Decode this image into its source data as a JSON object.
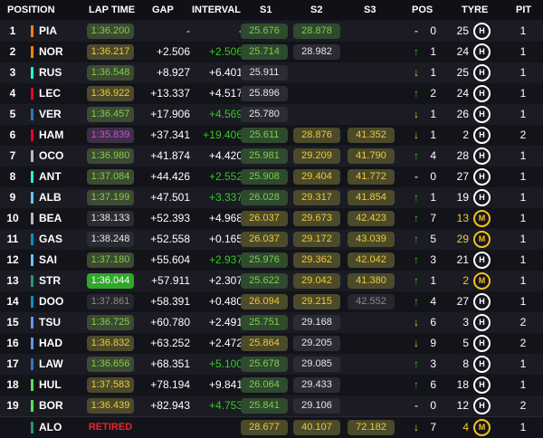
{
  "header": {
    "position": "POSITION",
    "lap_time": "LAP TIME",
    "gap": "GAP",
    "interval": "INTERVAL",
    "s1": "S1",
    "s2": "S2",
    "s3": "S3",
    "pos": "POS",
    "tyre": "TYRE",
    "pit": "PIT"
  },
  "colors": {
    "sector_green": "#7cd14a",
    "sector_yellow": "#efc93a",
    "purple": "#d04ee0",
    "interval_green": "#34c924",
    "retired_red": "#e8262c",
    "medium_tyre": "#f2c318"
  },
  "rows": [
    {
      "pos": "1",
      "driver": "PIA",
      "team_color": "#ff8000",
      "lap": "1:36.200",
      "lap_style": "green",
      "gap": "-",
      "interval": "-",
      "interval_green": false,
      "s1": "25.676",
      "s1_style": "green",
      "s2": "28.878",
      "s2_style": "green",
      "s3": "",
      "s3_style": "",
      "pos_arrow": "-",
      "pos_dir": "same",
      "pos_change": "0",
      "tyre_age": "25",
      "age_style": "",
      "tyre": "H",
      "tyre_type": "hard",
      "pit": "1"
    },
    {
      "pos": "2",
      "driver": "NOR",
      "team_color": "#ff8000",
      "lap": "1:36.217",
      "lap_style": "ylw",
      "gap": "+2.506",
      "interval": "+2.506",
      "interval_green": true,
      "s1": "25.714",
      "s1_style": "green",
      "s2": "28.982",
      "s2_style": "plain",
      "s3": "",
      "s3_style": "",
      "pos_arrow": "↑",
      "pos_dir": "up",
      "pos_change": "1",
      "tyre_age": "24",
      "age_style": "",
      "tyre": "H",
      "tyre_type": "hard",
      "pit": "1"
    },
    {
      "pos": "3",
      "driver": "RUS",
      "team_color": "#27f4d2",
      "lap": "1:36.548",
      "lap_style": "green",
      "gap": "+8.927",
      "interval": "+6.401",
      "interval_green": false,
      "s1": "25.911",
      "s1_style": "plain",
      "s2": "",
      "s2_style": "",
      "s3": "",
      "s3_style": "",
      "pos_arrow": "↓",
      "pos_dir": "down",
      "pos_change": "1",
      "tyre_age": "25",
      "age_style": "",
      "tyre": "H",
      "tyre_type": "hard",
      "pit": "1"
    },
    {
      "pos": "4",
      "driver": "LEC",
      "team_color": "#e8002d",
      "lap": "1:36.922",
      "lap_style": "ylw",
      "gap": "+13.337",
      "interval": "+4.517",
      "interval_green": false,
      "s1": "25.896",
      "s1_style": "plain",
      "s2": "",
      "s2_style": "",
      "s3": "",
      "s3_style": "",
      "pos_arrow": "↑",
      "pos_dir": "up",
      "pos_change": "2",
      "tyre_age": "24",
      "age_style": "",
      "tyre": "H",
      "tyre_type": "hard",
      "pit": "1"
    },
    {
      "pos": "5",
      "driver": "VER",
      "team_color": "#3671c6",
      "lap": "1:36.457",
      "lap_style": "green",
      "gap": "+17.906",
      "interval": "+4.569",
      "interval_green": true,
      "s1": "25.780",
      "s1_style": "plain",
      "s2": "",
      "s2_style": "",
      "s3": "",
      "s3_style": "",
      "pos_arrow": "↓",
      "pos_dir": "down",
      "pos_change": "1",
      "tyre_age": "26",
      "age_style": "",
      "tyre": "H",
      "tyre_type": "hard",
      "pit": "1"
    },
    {
      "pos": "6",
      "driver": "HAM",
      "team_color": "#e8002d",
      "lap": "1:35.839",
      "lap_style": "purple",
      "gap": "+37.341",
      "interval": "+19.406",
      "interval_green": true,
      "s1": "25.611",
      "s1_style": "green",
      "s2": "28.876",
      "s2_style": "ylw",
      "s3": "41.352",
      "s3_style": "ylw",
      "pos_arrow": "↓",
      "pos_dir": "down",
      "pos_change": "1",
      "tyre_age": "2",
      "age_style": "",
      "tyre": "H",
      "tyre_type": "hard",
      "pit": "2"
    },
    {
      "pos": "7",
      "driver": "OCO",
      "team_color": "#b6babd",
      "lap": "1:36.980",
      "lap_style": "green",
      "gap": "+41.874",
      "interval": "+4.420",
      "interval_green": false,
      "s1": "25.981",
      "s1_style": "green",
      "s2": "29.209",
      "s2_style": "ylw",
      "s3": "41.790",
      "s3_style": "ylw",
      "pos_arrow": "↑",
      "pos_dir": "up",
      "pos_change": "4",
      "tyre_age": "28",
      "age_style": "",
      "tyre": "H",
      "tyre_type": "hard",
      "pit": "1"
    },
    {
      "pos": "8",
      "driver": "ANT",
      "team_color": "#27f4d2",
      "lap": "1:37.084",
      "lap_style": "green",
      "gap": "+44.426",
      "interval": "+2.552",
      "interval_green": true,
      "s1": "25.908",
      "s1_style": "green",
      "s2": "29.404",
      "s2_style": "ylw",
      "s3": "41.772",
      "s3_style": "ylw",
      "pos_arrow": "-",
      "pos_dir": "same",
      "pos_change": "0",
      "tyre_age": "27",
      "age_style": "",
      "tyre": "H",
      "tyre_type": "hard",
      "pit": "1"
    },
    {
      "pos": "9",
      "driver": "ALB",
      "team_color": "#64c4ff",
      "lap": "1:37.199",
      "lap_style": "green",
      "gap": "+47.501",
      "interval": "+3.337",
      "interval_green": true,
      "s1": "26.028",
      "s1_style": "green",
      "s2": "29.317",
      "s2_style": "ylw",
      "s3": "41.854",
      "s3_style": "ylw",
      "pos_arrow": "↑",
      "pos_dir": "up",
      "pos_change": "1",
      "tyre_age": "19",
      "age_style": "",
      "tyre": "H",
      "tyre_type": "hard",
      "pit": "1"
    },
    {
      "pos": "10",
      "driver": "BEA",
      "team_color": "#b6babd",
      "lap": "1:38.133",
      "lap_style": "plain",
      "gap": "+52.393",
      "interval": "+4.968",
      "interval_green": false,
      "s1": "26.037",
      "s1_style": "ylw",
      "s2": "29.673",
      "s2_style": "ylw",
      "s3": "42.423",
      "s3_style": "ylw",
      "pos_arrow": "↑",
      "pos_dir": "up",
      "pos_change": "7",
      "tyre_age": "13",
      "age_style": "ylw",
      "tyre": "M",
      "tyre_type": "medium",
      "pit": "1"
    },
    {
      "pos": "11",
      "driver": "GAS",
      "team_color": "#0093cc",
      "lap": "1:38.248",
      "lap_style": "plain",
      "gap": "+52.558",
      "interval": "+0.165",
      "interval_green": false,
      "s1": "26.037",
      "s1_style": "ylw",
      "s2": "29.172",
      "s2_style": "ylw",
      "s3": "43.039",
      "s3_style": "ylw",
      "pos_arrow": "↑",
      "pos_dir": "up",
      "pos_change": "5",
      "tyre_age": "29",
      "age_style": "ylw",
      "tyre": "M",
      "tyre_type": "medium",
      "pit": "1"
    },
    {
      "pos": "12",
      "driver": "SAI",
      "team_color": "#64c4ff",
      "lap": "1:37.180",
      "lap_style": "green",
      "gap": "+55.604",
      "interval": "+2.937",
      "interval_green": true,
      "s1": "25.976",
      "s1_style": "green",
      "s2": "29.362",
      "s2_style": "ylw",
      "s3": "42.042",
      "s3_style": "ylw",
      "pos_arrow": "↑",
      "pos_dir": "up",
      "pos_change": "3",
      "tyre_age": "21",
      "age_style": "",
      "tyre": "H",
      "tyre_type": "hard",
      "pit": "1"
    },
    {
      "pos": "13",
      "driver": "STR",
      "team_color": "#229971",
      "lap": "1:36.044",
      "lap_style": "best",
      "gap": "+57.911",
      "interval": "+2.307",
      "interval_green": false,
      "s1": "25.622",
      "s1_style": "green",
      "s2": "29.042",
      "s2_style": "ylw",
      "s3": "41.380",
      "s3_style": "ylw",
      "pos_arrow": "↑",
      "pos_dir": "up",
      "pos_change": "1",
      "tyre_age": "2",
      "age_style": "ylw",
      "tyre": "M",
      "tyre_type": "medium",
      "pit": "1"
    },
    {
      "pos": "14",
      "driver": "DOO",
      "team_color": "#0093cc",
      "lap": "1:37.861",
      "lap_style": "gray",
      "gap": "+58.391",
      "interval": "+0.480",
      "interval_green": false,
      "s1": "26.094",
      "s1_style": "ylw",
      "s2": "29.215",
      "s2_style": "ylw",
      "s3": "42.552",
      "s3_style": "gray",
      "pos_arrow": "↑",
      "pos_dir": "up",
      "pos_change": "4",
      "tyre_age": "27",
      "age_style": "",
      "tyre": "H",
      "tyre_type": "hard",
      "pit": "1"
    },
    {
      "pos": "15",
      "driver": "TSU",
      "team_color": "#6692ff",
      "lap": "1:36.725",
      "lap_style": "green",
      "gap": "+60.780",
      "interval": "+2.491",
      "interval_green": false,
      "s1": "25.751",
      "s1_style": "green",
      "s2": "29.168",
      "s2_style": "plain",
      "s3": "",
      "s3_style": "",
      "pos_arrow": "↓",
      "pos_dir": "down",
      "pos_change": "6",
      "tyre_age": "3",
      "age_style": "",
      "tyre": "H",
      "tyre_type": "hard",
      "pit": "2"
    },
    {
      "pos": "16",
      "driver": "HAD",
      "team_color": "#6692ff",
      "lap": "1:36.832",
      "lap_style": "ylw",
      "gap": "+63.252",
      "interval": "+2.472",
      "interval_green": false,
      "s1": "25.864",
      "s1_style": "ylw",
      "s2": "29.205",
      "s2_style": "plain",
      "s3": "",
      "s3_style": "",
      "pos_arrow": "↓",
      "pos_dir": "down",
      "pos_change": "9",
      "tyre_age": "5",
      "age_style": "",
      "tyre": "H",
      "tyre_type": "hard",
      "pit": "2"
    },
    {
      "pos": "17",
      "driver": "LAW",
      "team_color": "#3671c6",
      "lap": "1:36.656",
      "lap_style": "green",
      "gap": "+68.351",
      "interval": "+5.100",
      "interval_green": true,
      "s1": "25.678",
      "s1_style": "green",
      "s2": "29.085",
      "s2_style": "plain",
      "s3": "",
      "s3_style": "",
      "pos_arrow": "↑",
      "pos_dir": "up",
      "pos_change": "3",
      "tyre_age": "8",
      "age_style": "",
      "tyre": "H",
      "tyre_type": "hard",
      "pit": "1"
    },
    {
      "pos": "18",
      "driver": "HUL",
      "team_color": "#52e252",
      "lap": "1:37.583",
      "lap_style": "ylw",
      "gap": "+78.194",
      "interval": "+9.841",
      "interval_green": false,
      "s1": "26.064",
      "s1_style": "green",
      "s2": "29.433",
      "s2_style": "plain",
      "s3": "",
      "s3_style": "",
      "pos_arrow": "↑",
      "pos_dir": "up",
      "pos_change": "6",
      "tyre_age": "18",
      "age_style": "",
      "tyre": "H",
      "tyre_type": "hard",
      "pit": "1"
    },
    {
      "pos": "19",
      "driver": "BOR",
      "team_color": "#52e252",
      "lap": "1:36.439",
      "lap_style": "ylw",
      "gap": "+82.943",
      "interval": "+4.753",
      "interval_green": true,
      "s1": "25.841",
      "s1_style": "green",
      "s2": "29.106",
      "s2_style": "plain",
      "s3": "",
      "s3_style": "",
      "pos_arrow": "-",
      "pos_dir": "same",
      "pos_change": "0",
      "tyre_age": "12",
      "age_style": "",
      "tyre": "H",
      "tyre_type": "hard",
      "pit": "2"
    },
    {
      "pos": "",
      "driver": "ALO",
      "team_color": "#229971",
      "lap": "RETIRED",
      "lap_style": "ret",
      "gap": "",
      "interval": "",
      "interval_green": false,
      "s1": "28.677",
      "s1_style": "ylw",
      "s2": "40.107",
      "s2_style": "ylw",
      "s3": "72.182",
      "s3_style": "ylw",
      "pos_arrow": "↓",
      "pos_dir": "down",
      "pos_change": "7",
      "tyre_age": "4",
      "age_style": "ylw",
      "tyre": "M",
      "tyre_type": "medium",
      "pit": "1"
    }
  ]
}
